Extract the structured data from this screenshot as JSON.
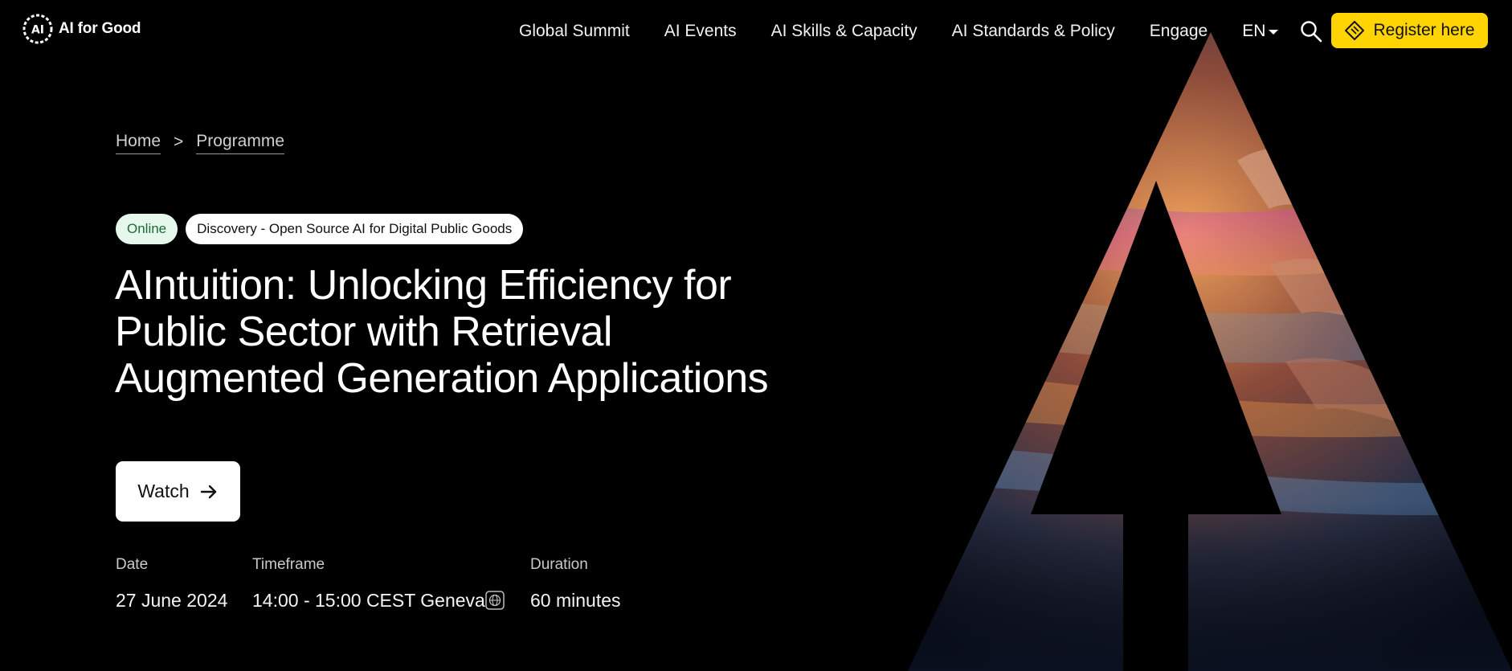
{
  "header": {
    "logo_text": "AI for Good",
    "nav": [
      "Global Summit",
      "AI Events",
      "AI Skills & Capacity",
      "AI Standards & Policy",
      "Engage"
    ],
    "language": "EN",
    "register_label": "Register here",
    "accent_color": "#ffd400"
  },
  "breadcrumb": {
    "items": [
      "Home",
      "Programme"
    ],
    "separator": ">"
  },
  "tags": {
    "status": "Online",
    "track": "Discovery - Open Source AI for Digital Public Goods"
  },
  "title": "AIntuition: Unlocking Efficiency for Public Sector with Retrieval Augmented Generation Applications",
  "watch_label": "Watch",
  "details": {
    "date_label": "Date",
    "date_value": "27 June 2024",
    "timeframe_label": "Timeframe",
    "timeframe_value": "14:00 - 15:00 CEST Geneva",
    "duration_label": "Duration",
    "duration_value": "60 minutes"
  },
  "icons": {
    "logo": "ai-for-good-logo-icon",
    "language_caret": "chevron-down-icon",
    "search": "search-icon",
    "register": "ticket-icon",
    "watch": "arrow-right-icon",
    "timezone": "globe-icon"
  }
}
